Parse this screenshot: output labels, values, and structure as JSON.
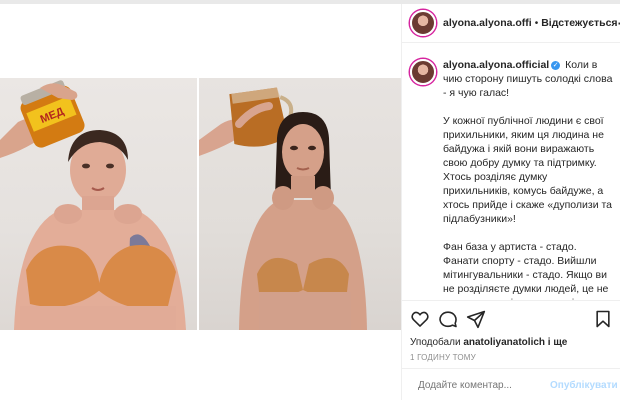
{
  "post": {
    "username": "alyona.alyona.offi",
    "follow_status": "Відстежується",
    "more_icon": "more-horizontal-icon"
  },
  "caption": {
    "author": "alyona.alyona.official",
    "text": "Коли в чию сторону пишуть солодкі слова - я чую галас!",
    "paragraphs": [
      "У кожної публічної людини є свої прихильники, яким ця людина не байдужа і якій вони виражають свою добру думку та підтримку. Хтось розділяє думку прихильників, комусь байдуже, а хтось прийде і скаже «дуполизи та підлабузники»!",
      "Фан база у артиста - стадо. Фанати спорту - стадо. Вийшли мітингувальники - стадо. Якщо ви не розділяєте думки людей, це не означає, що ці люди не вміють думати/аналізувати/відчувати/любити/поважати, не порушуючи чужих позицій! Це просто ...ля вибір. Ів"
    ]
  },
  "actions": {
    "icons": [
      "heart-icon",
      "comment-icon",
      "share-icon",
      "bookmark-icon"
    ]
  },
  "likes": {
    "prefix": "Уподобали",
    "user": "anatoliyanatolich",
    "suffix": "і ще"
  },
  "timestamp": "1 ГОДИНУ ТОМУ",
  "comment_box": {
    "placeholder": "Додайте коментар...",
    "post_label": "Опублікувати",
    "emoji_icon": "emoji-icon"
  },
  "photo": {
    "left_jar_label": "МЕД"
  },
  "colors": {
    "verified": "#3897f0",
    "post_button": "#b3dbff",
    "story_ring": "#d6249f"
  }
}
